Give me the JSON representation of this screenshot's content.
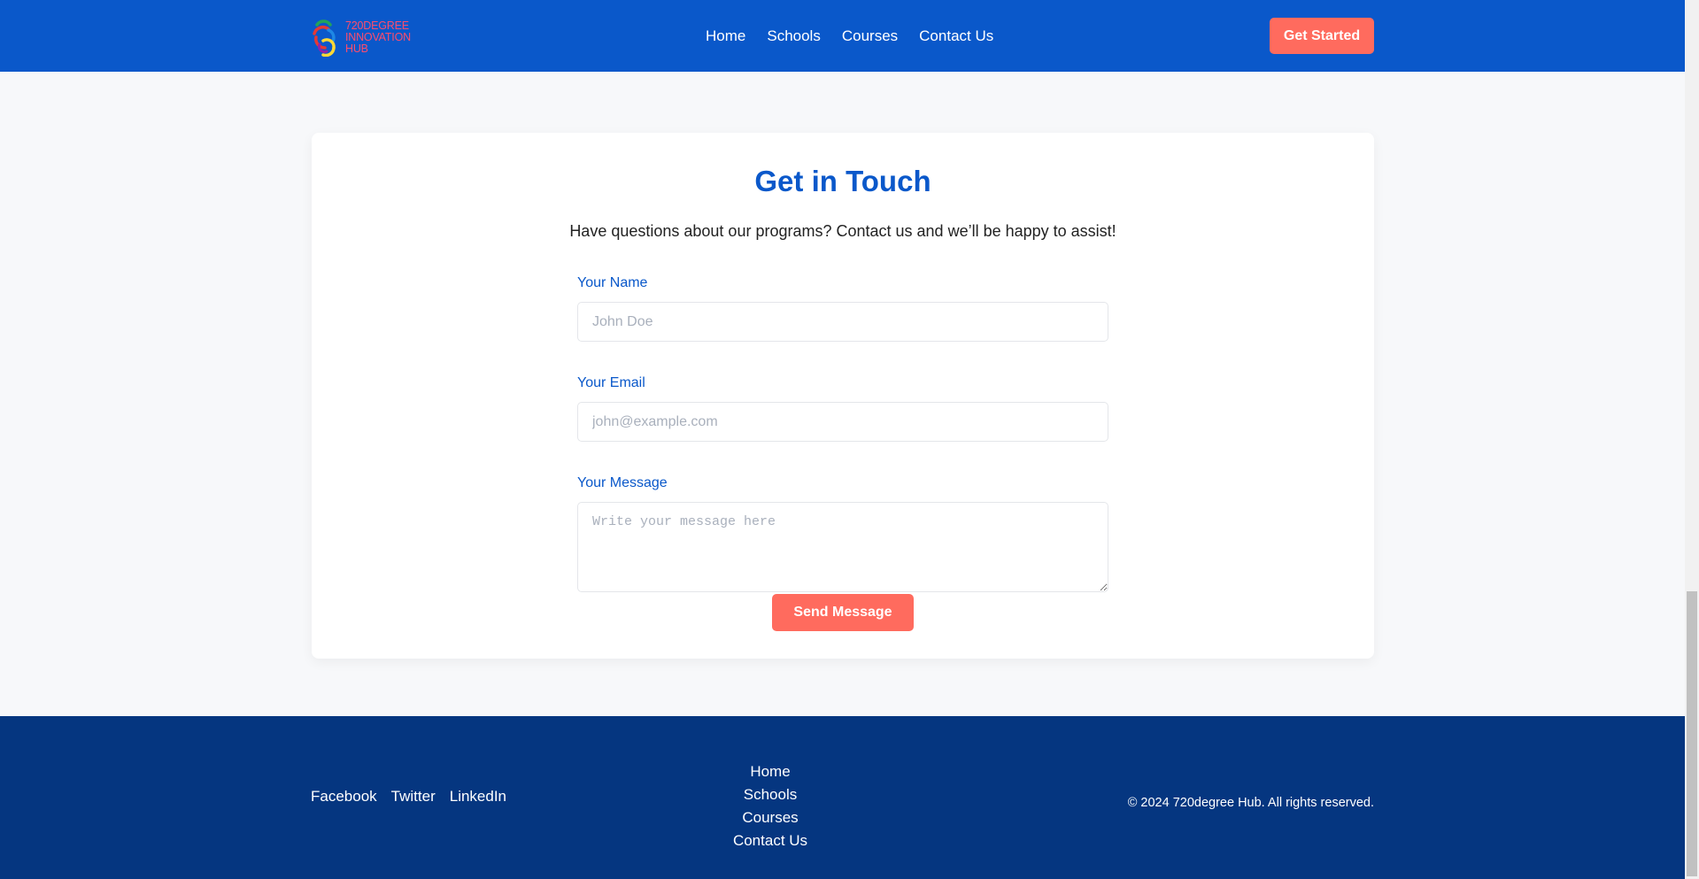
{
  "header": {
    "logo_lines": [
      "720DEGREE",
      "INNOVATION",
      "HUB"
    ],
    "nav": [
      "Home",
      "Schools",
      "Courses",
      "Contact Us"
    ],
    "cta_label": "Get Started"
  },
  "contact": {
    "title": "Get in Touch",
    "subtitle": "Have questions about our programs? Contact us and we’ll be happy to assist!",
    "name_label": "Your Name",
    "name_placeholder": "John Doe",
    "email_label": "Your Email",
    "email_placeholder": "john@example.com",
    "message_label": "Your Message",
    "message_placeholder": "Write your message here",
    "submit_label": "Send Message"
  },
  "footer": {
    "social": [
      "Facebook",
      "Twitter",
      "LinkedIn"
    ],
    "links": [
      "Home",
      "Schools",
      "Courses",
      "Contact Us"
    ],
    "copyright": "© 2024 720degree Hub. All rights reserved."
  },
  "colors": {
    "header_bg": "#0a58ca",
    "accent": "#ff6b5e",
    "title": "#0a58ca",
    "footer_bg": "#053680",
    "logo_text": "#ff4d6d"
  },
  "icons": {
    "logo": "interlocking-rings-logo-icon"
  },
  "scroll": {
    "position": 1.0
  }
}
